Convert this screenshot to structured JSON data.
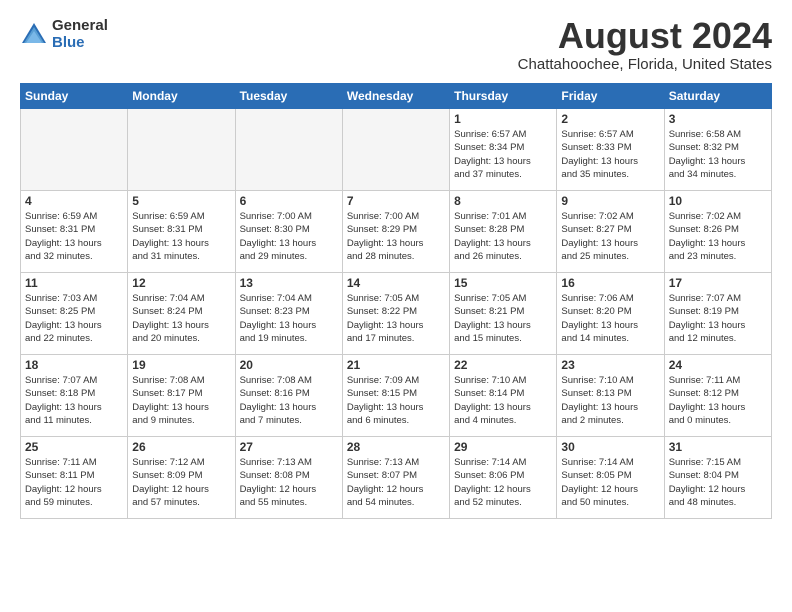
{
  "logo": {
    "general": "General",
    "blue": "Blue"
  },
  "title": "August 2024",
  "location": "Chattahoochee, Florida, United States",
  "weekdays": [
    "Sunday",
    "Monday",
    "Tuesday",
    "Wednesday",
    "Thursday",
    "Friday",
    "Saturday"
  ],
  "weeks": [
    [
      {
        "day": "",
        "info": ""
      },
      {
        "day": "",
        "info": ""
      },
      {
        "day": "",
        "info": ""
      },
      {
        "day": "",
        "info": ""
      },
      {
        "day": "1",
        "info": "Sunrise: 6:57 AM\nSunset: 8:34 PM\nDaylight: 13 hours\nand 37 minutes."
      },
      {
        "day": "2",
        "info": "Sunrise: 6:57 AM\nSunset: 8:33 PM\nDaylight: 13 hours\nand 35 minutes."
      },
      {
        "day": "3",
        "info": "Sunrise: 6:58 AM\nSunset: 8:32 PM\nDaylight: 13 hours\nand 34 minutes."
      }
    ],
    [
      {
        "day": "4",
        "info": "Sunrise: 6:59 AM\nSunset: 8:31 PM\nDaylight: 13 hours\nand 32 minutes."
      },
      {
        "day": "5",
        "info": "Sunrise: 6:59 AM\nSunset: 8:31 PM\nDaylight: 13 hours\nand 31 minutes."
      },
      {
        "day": "6",
        "info": "Sunrise: 7:00 AM\nSunset: 8:30 PM\nDaylight: 13 hours\nand 29 minutes."
      },
      {
        "day": "7",
        "info": "Sunrise: 7:00 AM\nSunset: 8:29 PM\nDaylight: 13 hours\nand 28 minutes."
      },
      {
        "day": "8",
        "info": "Sunrise: 7:01 AM\nSunset: 8:28 PM\nDaylight: 13 hours\nand 26 minutes."
      },
      {
        "day": "9",
        "info": "Sunrise: 7:02 AM\nSunset: 8:27 PM\nDaylight: 13 hours\nand 25 minutes."
      },
      {
        "day": "10",
        "info": "Sunrise: 7:02 AM\nSunset: 8:26 PM\nDaylight: 13 hours\nand 23 minutes."
      }
    ],
    [
      {
        "day": "11",
        "info": "Sunrise: 7:03 AM\nSunset: 8:25 PM\nDaylight: 13 hours\nand 22 minutes."
      },
      {
        "day": "12",
        "info": "Sunrise: 7:04 AM\nSunset: 8:24 PM\nDaylight: 13 hours\nand 20 minutes."
      },
      {
        "day": "13",
        "info": "Sunrise: 7:04 AM\nSunset: 8:23 PM\nDaylight: 13 hours\nand 19 minutes."
      },
      {
        "day": "14",
        "info": "Sunrise: 7:05 AM\nSunset: 8:22 PM\nDaylight: 13 hours\nand 17 minutes."
      },
      {
        "day": "15",
        "info": "Sunrise: 7:05 AM\nSunset: 8:21 PM\nDaylight: 13 hours\nand 15 minutes."
      },
      {
        "day": "16",
        "info": "Sunrise: 7:06 AM\nSunset: 8:20 PM\nDaylight: 13 hours\nand 14 minutes."
      },
      {
        "day": "17",
        "info": "Sunrise: 7:07 AM\nSunset: 8:19 PM\nDaylight: 13 hours\nand 12 minutes."
      }
    ],
    [
      {
        "day": "18",
        "info": "Sunrise: 7:07 AM\nSunset: 8:18 PM\nDaylight: 13 hours\nand 11 minutes."
      },
      {
        "day": "19",
        "info": "Sunrise: 7:08 AM\nSunset: 8:17 PM\nDaylight: 13 hours\nand 9 minutes."
      },
      {
        "day": "20",
        "info": "Sunrise: 7:08 AM\nSunset: 8:16 PM\nDaylight: 13 hours\nand 7 minutes."
      },
      {
        "day": "21",
        "info": "Sunrise: 7:09 AM\nSunset: 8:15 PM\nDaylight: 13 hours\nand 6 minutes."
      },
      {
        "day": "22",
        "info": "Sunrise: 7:10 AM\nSunset: 8:14 PM\nDaylight: 13 hours\nand 4 minutes."
      },
      {
        "day": "23",
        "info": "Sunrise: 7:10 AM\nSunset: 8:13 PM\nDaylight: 13 hours\nand 2 minutes."
      },
      {
        "day": "24",
        "info": "Sunrise: 7:11 AM\nSunset: 8:12 PM\nDaylight: 13 hours\nand 0 minutes."
      }
    ],
    [
      {
        "day": "25",
        "info": "Sunrise: 7:11 AM\nSunset: 8:11 PM\nDaylight: 12 hours\nand 59 minutes."
      },
      {
        "day": "26",
        "info": "Sunrise: 7:12 AM\nSunset: 8:09 PM\nDaylight: 12 hours\nand 57 minutes."
      },
      {
        "day": "27",
        "info": "Sunrise: 7:13 AM\nSunset: 8:08 PM\nDaylight: 12 hours\nand 55 minutes."
      },
      {
        "day": "28",
        "info": "Sunrise: 7:13 AM\nSunset: 8:07 PM\nDaylight: 12 hours\nand 54 minutes."
      },
      {
        "day": "29",
        "info": "Sunrise: 7:14 AM\nSunset: 8:06 PM\nDaylight: 12 hours\nand 52 minutes."
      },
      {
        "day": "30",
        "info": "Sunrise: 7:14 AM\nSunset: 8:05 PM\nDaylight: 12 hours\nand 50 minutes."
      },
      {
        "day": "31",
        "info": "Sunrise: 7:15 AM\nSunset: 8:04 PM\nDaylight: 12 hours\nand 48 minutes."
      }
    ]
  ]
}
